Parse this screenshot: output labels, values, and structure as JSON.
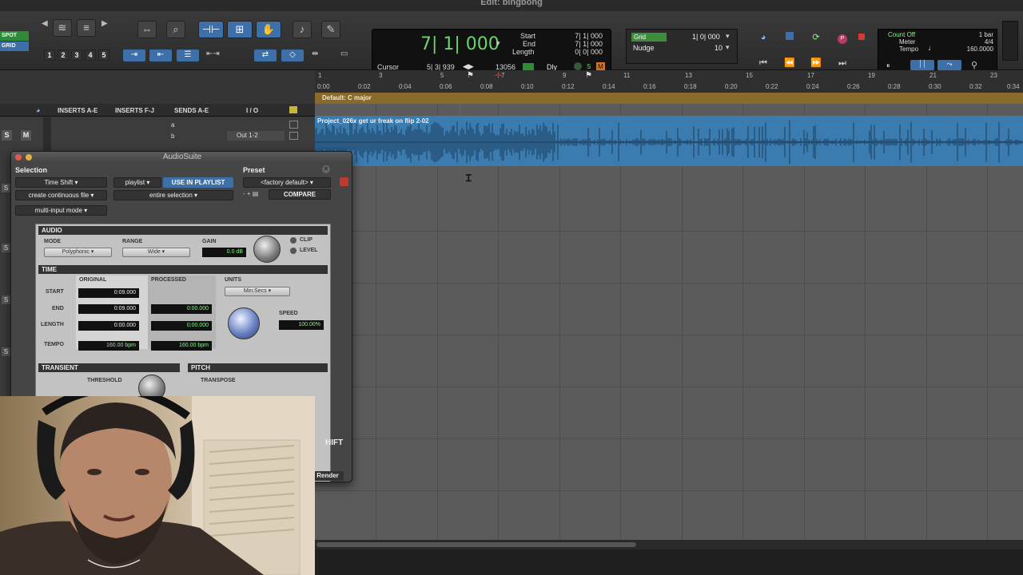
{
  "window": {
    "title": "Edit: bingbong"
  },
  "toolbar": {
    "mode_spot": "SPOT",
    "mode_grid": "GRID",
    "zoom_presets": [
      "1",
      "2",
      "3",
      "4",
      "5"
    ]
  },
  "counter": {
    "main": "7| 1| 000",
    "start_label": "Start",
    "start_value": "7| 1| 000",
    "end_label": "End",
    "end_value": "7| 1| 000",
    "length_label": "Length",
    "length_value": "0| 0| 000",
    "cursor_label": "Cursor",
    "cursor_value": "5| 3| 939",
    "sample_value": "13056",
    "dly_label": "Dly"
  },
  "grid": {
    "grid_label": "Grid",
    "grid_value": "1| 0| 000",
    "nudge_label": "Nudge",
    "nudge_value": "10"
  },
  "meter": {
    "count_off": "Count Off",
    "meter_label": "Meter",
    "tempo_label": "Tempo",
    "bars": "1 bar",
    "meter_value": "4/4",
    "tempo_value": "160.0000"
  },
  "ruler": {
    "bars": [
      "1",
      "3",
      "5",
      "7",
      "9",
      "11",
      "13",
      "15",
      "17",
      "19",
      "21",
      "23"
    ],
    "mins": [
      "0:00",
      "0:02",
      "0:04",
      "0:06",
      "0:08",
      "0:10",
      "0:12",
      "0:14",
      "0:16",
      "0:18",
      "0:20",
      "0:22",
      "0:24",
      "0:26",
      "0:28",
      "0:30",
      "0:32",
      "0:34"
    ],
    "key_label": "Default: C major"
  },
  "mix_header": {
    "inserts_ae": "INSERTS A-E",
    "inserts_fj": "INSERTS F-J",
    "sends_ae": "SENDS A-E",
    "io": "I / O",
    "send_a": "a",
    "send_b": "b",
    "output": "Out 1-2",
    "solo": "S",
    "mute": "M"
  },
  "clip": {
    "name": "Project_026x get ur freak on flip 2-02"
  },
  "audiosuite": {
    "title": "AudioSuite",
    "selection_label": "Selection",
    "preset_label": "Preset",
    "plugin_name": "Time Shift",
    "playlist": "playlist",
    "use_in_playlist": "USE IN PLAYLIST",
    "factory_default": "<factory default>",
    "create_file": "create continuous file",
    "entire_selection": "entire selection",
    "compare": "COMPARE",
    "multi_input": "multi-input mode",
    "render": "Render"
  },
  "plugin": {
    "audio_section": "AUDIO",
    "mode_label": "MODE",
    "mode_value": "Polyphonic",
    "range_label": "RANGE",
    "range_value": "Wide",
    "gain_label": "GAIN",
    "gain_value": "0.0 dB",
    "clip_label": "CLIP",
    "level_label": "LEVEL",
    "time_section": "TIME",
    "original_label": "ORIGINAL",
    "processed_label": "PROCESSED",
    "units_label": "UNITS",
    "units_value": "Min:Secs",
    "start_label": "START",
    "end_label": "END",
    "length_label": "LENGTH",
    "tempo_label": "TEMPO",
    "orig_start": "0:09.000",
    "orig_end": "0:09.000",
    "orig_length": "0:00.000",
    "orig_tempo": "160.00 bpm",
    "proc_start": "0:00.000",
    "proc_length": "0:00.000",
    "proc_tempo": "160.00 bpm",
    "speed_label": "SPEED",
    "speed_value": "100.00%",
    "transient_section": "TRANSIENT",
    "threshold_label": "THRESHOLD",
    "pitch_section": "PITCH",
    "transpose_label": "TRANSPOSE",
    "brand_fragment": "HIFT"
  },
  "colors": {
    "accent_blue": "#3d6fa8",
    "clip_blue": "#3a7bb0",
    "counter_green": "#6ed36e",
    "key_bar": "#8a6a2c",
    "record_red": "#d23a3a"
  }
}
